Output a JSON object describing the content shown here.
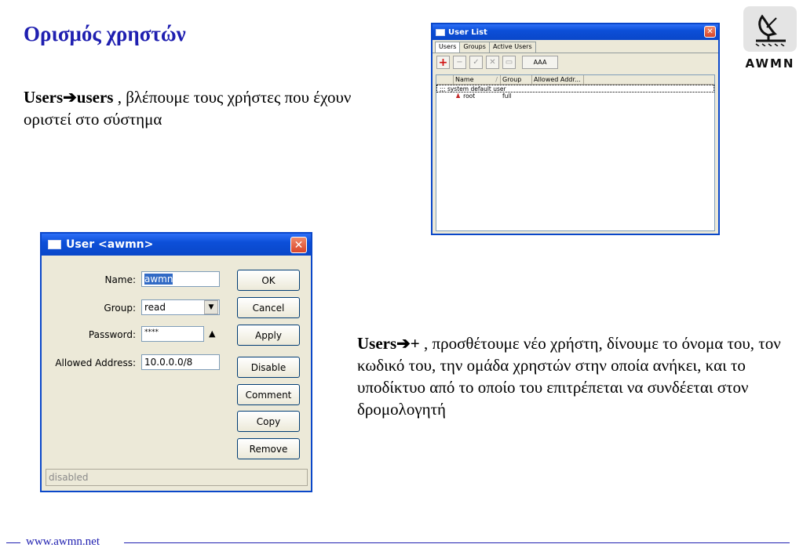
{
  "slide": {
    "title": "Ορισμός χρηστών",
    "text1": {
      "bold": "Users",
      "arrow": "➔",
      "bold2": "users",
      "rest": " , βλέπουμε τους χρήστες που έχουν οριστεί στο σύστημα"
    },
    "text2": {
      "bold": "Users",
      "arrow": "➔",
      "bold2": "+",
      "rest": " , προσθέτουμε νέο χρήστη, δίνουμε το όνομα του, τον κωδικό του, την ομάδα χρηστών στην οποία ανήκει, και το υποδίκτυο από το οποίο του επιτρέπεται να συνδέεται στον δρομολογητή"
    },
    "footer": "www.awmn.net",
    "logo_text": "AWMN"
  },
  "user_list": {
    "title": "User List",
    "close": "✕",
    "tabs": [
      "Users",
      "Groups",
      "Active Users"
    ],
    "toolbar": {
      "add": "+",
      "remove": "−",
      "enable": "✓",
      "disable": "✕",
      "comment": "▭",
      "aaa": "AAA"
    },
    "columns": [
      "Name",
      "Group",
      "Allowed Addr..."
    ],
    "sort_mark": "/",
    "comment_row": ";;; system default user",
    "rows": [
      {
        "name": "root",
        "group": "full",
        "allowed": ""
      }
    ]
  },
  "user_dialog": {
    "title": "User <awmn>",
    "close": "✕",
    "name_label": "Name:",
    "name_value": "awmn",
    "group_label": "Group:",
    "group_value": "read",
    "password_label": "Password:",
    "password_value": "****",
    "allowed_label": "Allowed Address:",
    "allowed_value": "10.0.0.0/8",
    "buttons": {
      "ok": "OK",
      "cancel": "Cancel",
      "apply": "Apply",
      "disable": "Disable",
      "comment": "Comment",
      "copy": "Copy",
      "remove": "Remove"
    },
    "status": "disabled"
  }
}
